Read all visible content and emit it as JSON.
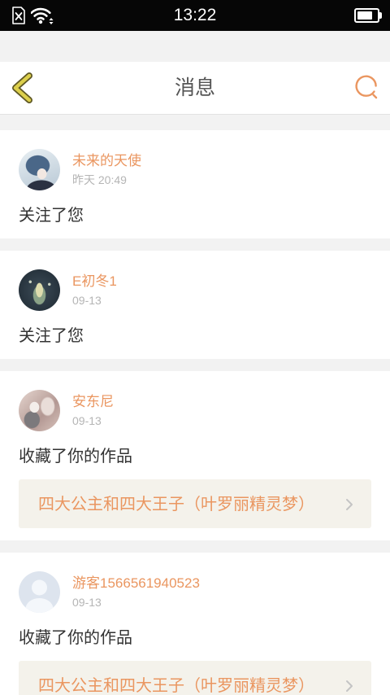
{
  "status_bar": {
    "time": "13:22",
    "battery_level": 0.8,
    "icons": [
      "no-sim-icon",
      "wifi-icon",
      "battery-icon"
    ]
  },
  "header": {
    "title": "消息",
    "back_icon": "back-chevron-icon",
    "search_icon": "search-icon"
  },
  "messages": [
    {
      "user": "未来的天使",
      "time": "昨天 20:49",
      "action": "关注了您"
    },
    {
      "user": "E初冬1",
      "time": "09-13",
      "action": "关注了您"
    },
    {
      "user": "安东尼",
      "time": "09-13",
      "action": "收藏了你的作品",
      "work": "四大公主和四大王子（叶罗丽精灵梦）",
      "work_icon": "chevron-right-icon"
    },
    {
      "user": "游客1566561940523",
      "time": "09-13",
      "action": "收藏了你的作品",
      "work": "四大公主和四大王子（叶罗丽精灵梦）",
      "work_icon": "chevron-right-icon",
      "avatar_icon": "default-avatar-icon"
    }
  ],
  "theme": {
    "accent": "#ea9660",
    "back_icon": "#dccf4c",
    "page_bg": "#f2f2f2",
    "work_bg": "#f4f2eb",
    "text": "#333333",
    "muted": "#b5b5b5",
    "title": "#555555"
  }
}
